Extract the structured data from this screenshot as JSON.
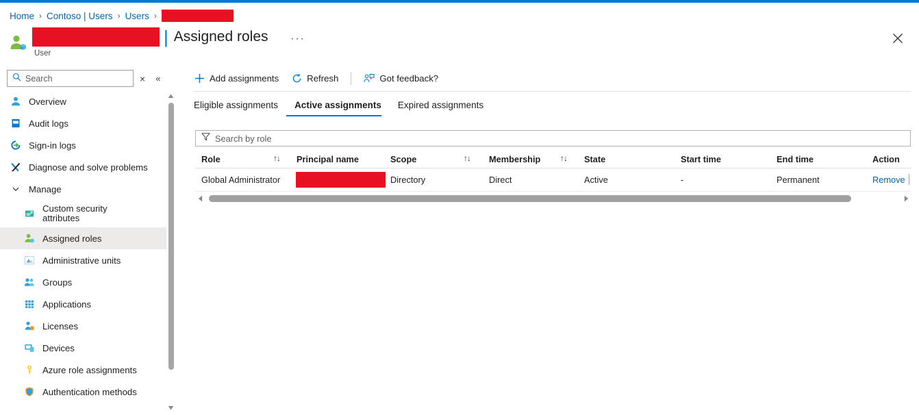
{
  "theme": {
    "accent": "#0078d4",
    "link": "#0065b3",
    "redaction": "#e81123",
    "selected_bg": "#edebe9"
  },
  "breadcrumb": {
    "items": [
      {
        "label": "Home",
        "redacted": false
      },
      {
        "label": "Contoso | Users",
        "redacted": false
      },
      {
        "label": "Users",
        "redacted": false
      },
      {
        "label": "",
        "redacted": true
      }
    ],
    "separator": "›"
  },
  "header": {
    "name_redacted": true,
    "separator": "|",
    "title": "Assigned roles",
    "subtitle": "User",
    "ellipsis": "···",
    "close_label": "Close"
  },
  "sidebar": {
    "search": {
      "placeholder": "Search",
      "value": ""
    },
    "clear_label": "×",
    "collapse_label": "«",
    "items": [
      {
        "label": "Overview",
        "icon": "user-icon",
        "level": 0,
        "selected": false
      },
      {
        "label": "Audit logs",
        "icon": "audit-log-icon",
        "level": 0,
        "selected": false
      },
      {
        "label": "Sign-in logs",
        "icon": "sign-in-icon",
        "level": 0,
        "selected": false
      },
      {
        "label": "Diagnose and solve problems",
        "icon": "wrench-icon",
        "level": 0,
        "selected": false
      },
      {
        "label": "Manage",
        "icon": "chevron-down-icon",
        "level": 0,
        "selected": false,
        "group": true
      },
      {
        "label": "Custom security attributes",
        "icon": "attributes-icon",
        "level": 1,
        "selected": false
      },
      {
        "label": "Assigned roles",
        "icon": "assigned-roles-icon",
        "level": 1,
        "selected": true
      },
      {
        "label": "Administrative units",
        "icon": "admin-units-icon",
        "level": 1,
        "selected": false
      },
      {
        "label": "Groups",
        "icon": "groups-icon",
        "level": 1,
        "selected": false
      },
      {
        "label": "Applications",
        "icon": "applications-icon",
        "level": 1,
        "selected": false
      },
      {
        "label": "Licenses",
        "icon": "licenses-icon",
        "level": 1,
        "selected": false
      },
      {
        "label": "Devices",
        "icon": "devices-icon",
        "level": 1,
        "selected": false
      },
      {
        "label": "Azure role assignments",
        "icon": "key-icon",
        "level": 1,
        "selected": false
      },
      {
        "label": "Authentication methods",
        "icon": "shield-icon",
        "level": 1,
        "selected": false
      }
    ]
  },
  "toolbar": {
    "add_label": "Add assignments",
    "refresh_label": "Refresh",
    "feedback_label": "Got feedback?"
  },
  "tabs": [
    {
      "label": "Eligible assignments",
      "active": false
    },
    {
      "label": "Active assignments",
      "active": true
    },
    {
      "label": "Expired assignments",
      "active": false
    }
  ],
  "filter": {
    "placeholder": "Search by role",
    "value": ""
  },
  "table": {
    "columns": [
      {
        "label": "Role",
        "sortable": true
      },
      {
        "label": "Principal name",
        "sortable": false
      },
      {
        "label": "Scope",
        "sortable": true
      },
      {
        "label": "Membership",
        "sortable": true
      },
      {
        "label": "State",
        "sortable": false
      },
      {
        "label": "Start time",
        "sortable": false
      },
      {
        "label": "End time",
        "sortable": false
      },
      {
        "label": "Action",
        "sortable": false
      }
    ],
    "sort_glyph": "↑↓",
    "rows": [
      {
        "role": "Global Administrator",
        "principal_name": "",
        "principal_redacted": true,
        "scope": "Directory",
        "membership": "Direct",
        "state": "Active",
        "start_time": "-",
        "end_time": "Permanent",
        "action": "Remove"
      }
    ]
  }
}
